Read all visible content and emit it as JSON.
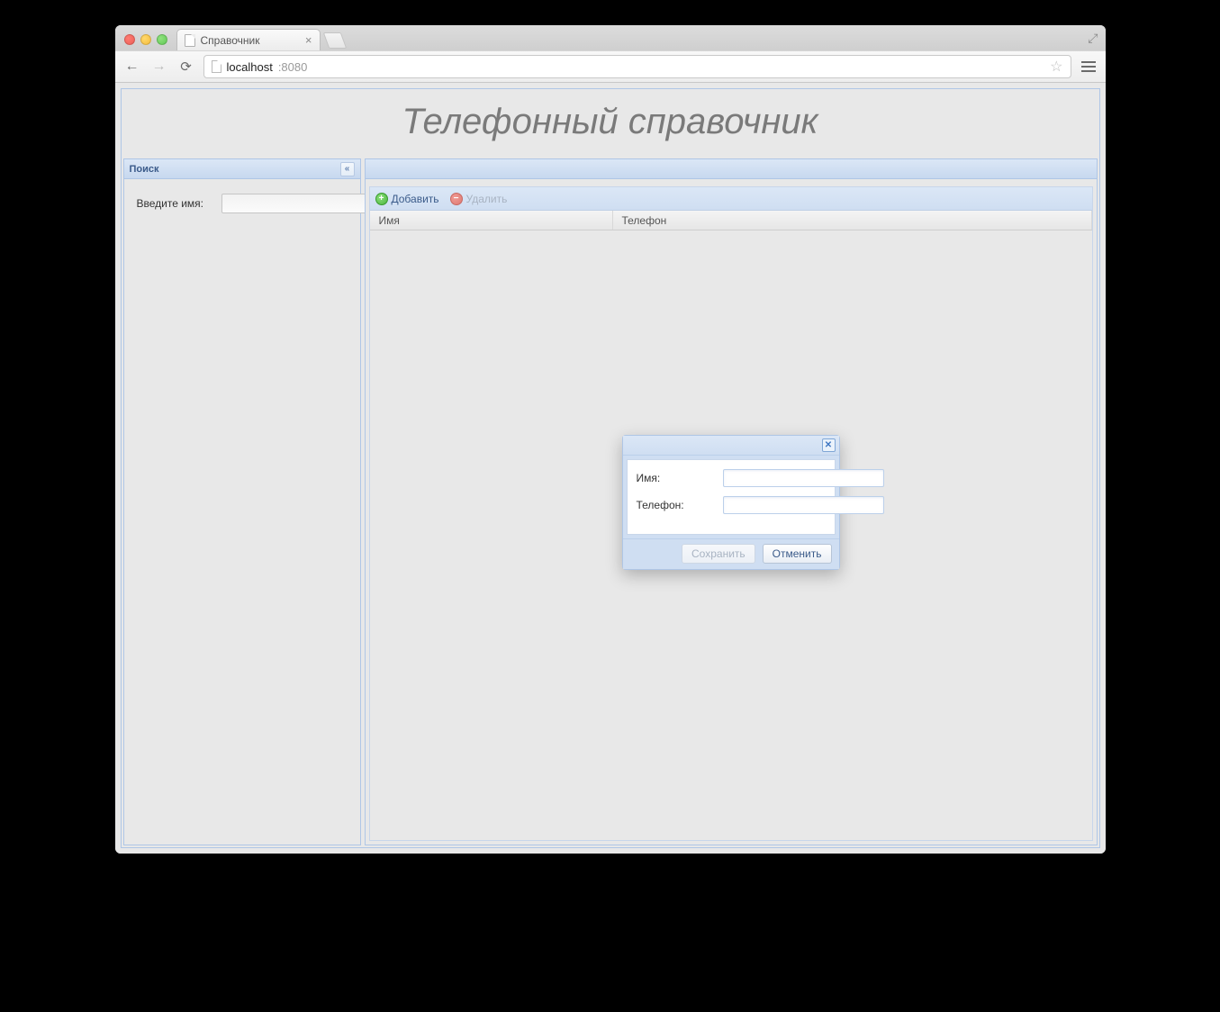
{
  "browser": {
    "tab_title": "Справочник",
    "url_host": "localhost",
    "url_port": ":8080"
  },
  "app": {
    "title": "Телефонный справочник"
  },
  "sidebar": {
    "header": "Поиск",
    "name_label": "Введите имя:",
    "name_value": ""
  },
  "grid": {
    "toolbar": {
      "add_label": "Добавить",
      "delete_label": "Удалить"
    },
    "columns": {
      "name": "Имя",
      "phone": "Телефон"
    },
    "rows": []
  },
  "dialog": {
    "name_label": "Имя:",
    "phone_label": "Телефон:",
    "name_value": "",
    "phone_value": "",
    "save_label": "Сохранить",
    "cancel_label": "Отменить"
  }
}
